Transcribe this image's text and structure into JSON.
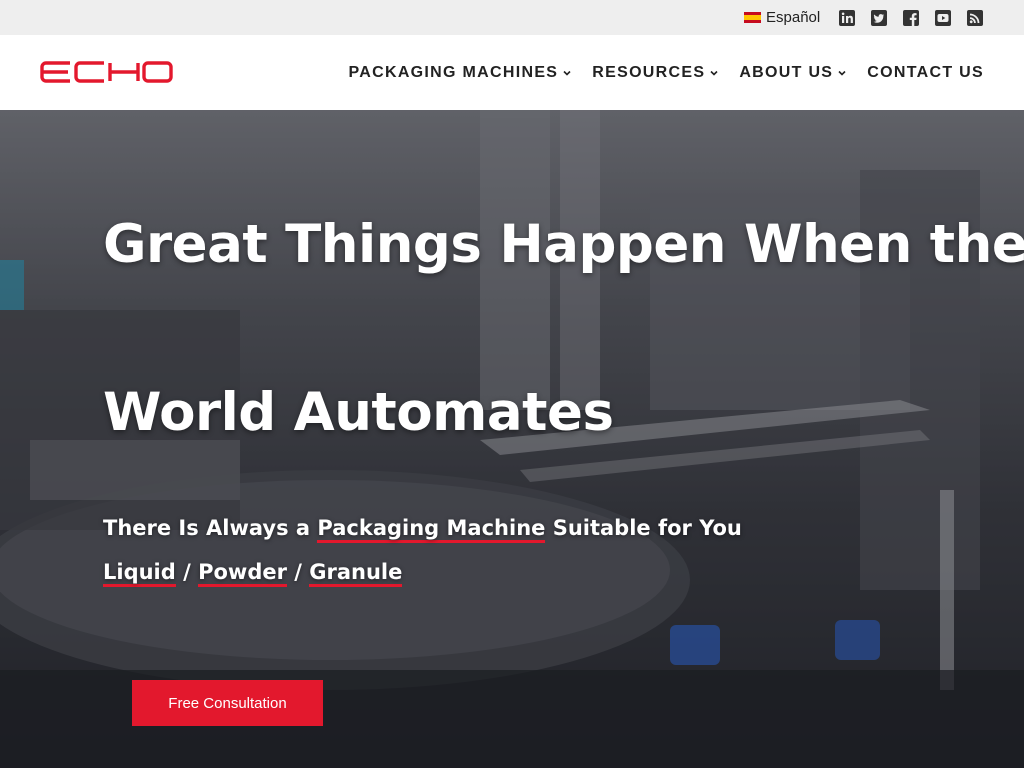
{
  "topbar": {
    "language": {
      "flag": "spain-flag-icon",
      "label": "Español"
    },
    "social": [
      {
        "name": "linkedin-icon"
      },
      {
        "name": "twitter-icon"
      },
      {
        "name": "facebook-icon"
      },
      {
        "name": "youtube-icon"
      },
      {
        "name": "rss-icon"
      }
    ]
  },
  "header": {
    "logo_text": "ECHO",
    "brand_color": "#e3182d",
    "nav": [
      {
        "label": "PACKAGING MACHINES",
        "has_dropdown": true
      },
      {
        "label": "RESOURCES",
        "has_dropdown": true
      },
      {
        "label": "ABOUT US",
        "has_dropdown": true
      },
      {
        "label": "CONTACT US",
        "has_dropdown": false
      }
    ]
  },
  "hero": {
    "headline_line1": "Great Things Happen When the",
    "headline_line2": "World Automates",
    "subline1": {
      "prefix": "There Is Always a ",
      "link": "Packaging Machine",
      "suffix": " Suitable for You"
    },
    "subline2": {
      "link1": "Liquid",
      "sep1": " / ",
      "link2": "Powder",
      "sep2": " / ",
      "link3": "Granule"
    },
    "cta_label": "Free Consultation"
  }
}
